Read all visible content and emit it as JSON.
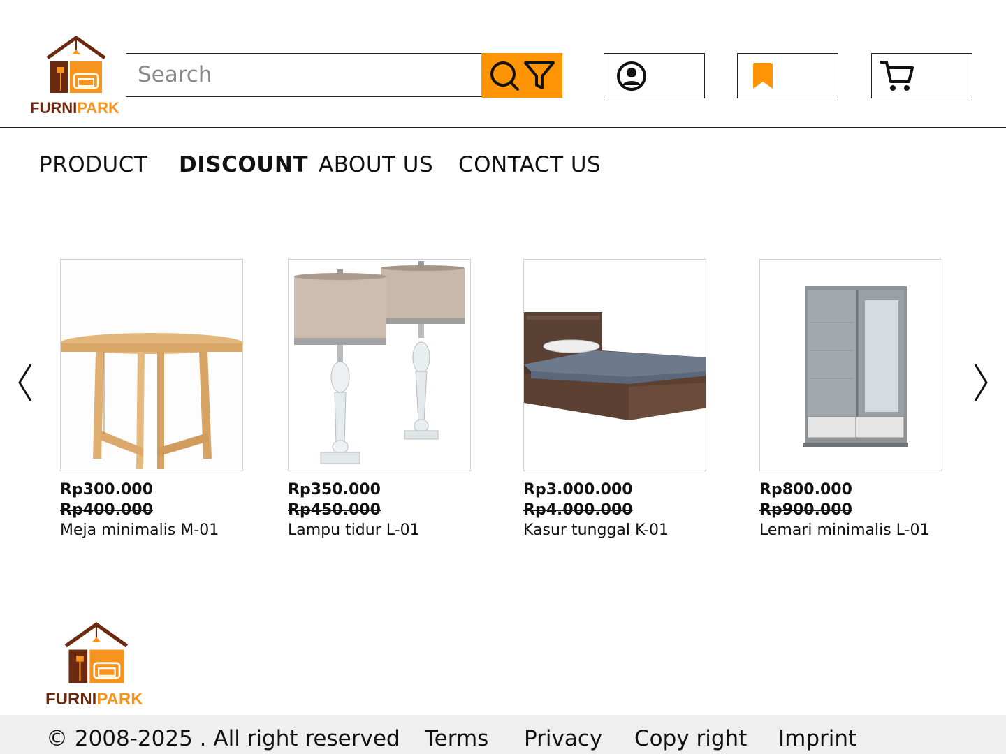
{
  "brand": {
    "name_part1": "FURNI",
    "name_part2": "PARK"
  },
  "colors": {
    "accent": "#ff9405",
    "brand_brown": "#6b2a10",
    "brand_orange": "#f7941d",
    "footer_bg": "#efefef"
  },
  "search": {
    "placeholder": "Search",
    "value": ""
  },
  "header": {
    "search_button_icons": [
      "search-icon",
      "filter-icon"
    ],
    "account_icon": "user-circle-icon",
    "bookmark_icon": "bookmark-icon",
    "cart_icon": "cart-icon"
  },
  "nav": {
    "items": [
      {
        "label": "PRODUCT",
        "active": false
      },
      {
        "label": "DISCOUNT",
        "active": true
      },
      {
        "label": "ABOUT US",
        "active": false
      },
      {
        "label": "CONTACT US",
        "active": false
      }
    ]
  },
  "products": [
    {
      "price": "Rp300.000",
      "old_price": "Rp400.000",
      "name": "Meja minimalis M-01",
      "image": "round-wooden-table"
    },
    {
      "price": "Rp350.000",
      "old_price": "Rp450.000",
      "name": "Lampu tidur L-01",
      "image": "crystal-table-lamps"
    },
    {
      "price": "Rp3.000.000",
      "old_price": "Rp4.000.000",
      "name": "Kasur tunggal K-01",
      "image": "single-bed"
    },
    {
      "price": "Rp800.000",
      "old_price": "Rp900.000",
      "name": "Lemari minimalis L-01",
      "image": "sliding-wardrobe"
    }
  ],
  "carousel": {
    "prev_icon": "chevron-left-icon",
    "next_icon": "chevron-right-icon"
  },
  "footer": {
    "copyright": "© 2008-2025 . All right reserved",
    "links": [
      "Terms",
      "Privacy",
      "Copy right",
      "Imprint"
    ]
  }
}
